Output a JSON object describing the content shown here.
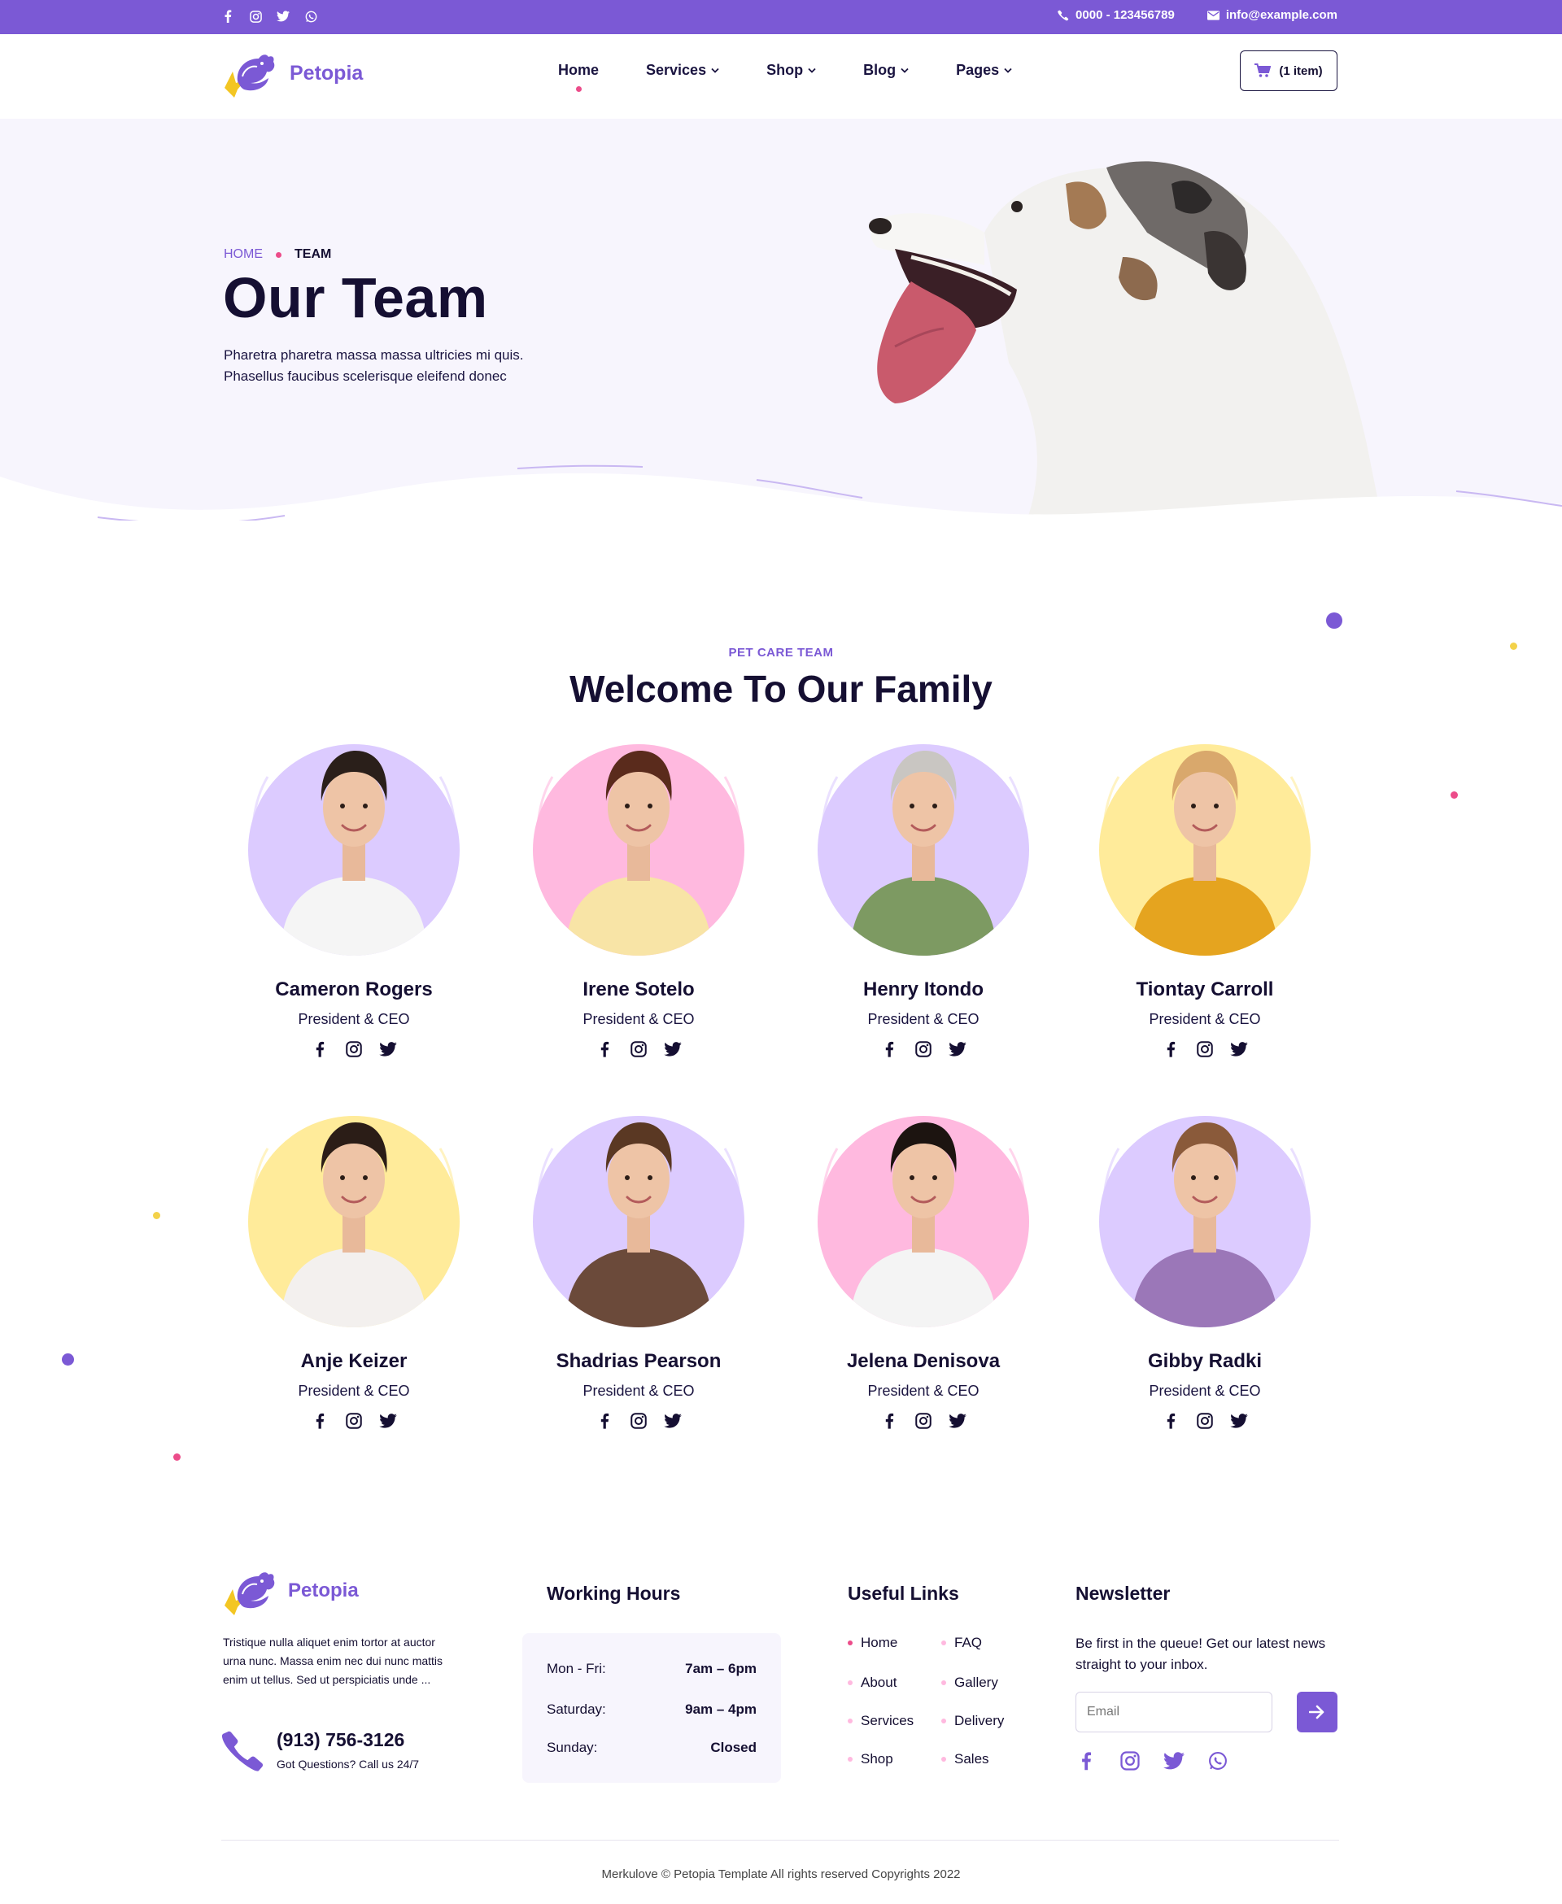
{
  "topbar": {
    "socials": [
      "facebook-icon",
      "instagram-icon",
      "twitter-icon",
      "whatsapp-icon"
    ],
    "phone": "0000 - 123456789",
    "email": "info@example.com"
  },
  "header": {
    "brand": "Petopia",
    "nav": [
      {
        "label": "Home",
        "active": true
      },
      {
        "label": "Services",
        "dropdown": true
      },
      {
        "label": "Shop",
        "dropdown": true
      },
      {
        "label": "Blog",
        "dropdown": true
      },
      {
        "label": "Pages",
        "dropdown": true
      }
    ],
    "cart_label": "(1 item)"
  },
  "hero": {
    "breadcrumb_home": "HOME",
    "breadcrumb_current": "TEAM",
    "title": "Our Team",
    "description_line1": "Pharetra pharetra massa massa ultricies mi quis.",
    "description_line2": "Phasellus faucibus scelerisque eleifend donec"
  },
  "team": {
    "subtitle": "PET CARE TEAM",
    "title": "Welcome To Our Family",
    "members": [
      {
        "name": "Cameron Rogers",
        "role": "President & CEO",
        "bg": "#dccbff",
        "shirt": "#f5f5f5",
        "hair": "#2a1f1a"
      },
      {
        "name": "Irene Sotelo",
        "role": "President & CEO",
        "bg": "#ffb9df",
        "shirt": "#f8e4a6",
        "hair": "#5a2b1c"
      },
      {
        "name": "Henry Itondo",
        "role": "President & CEO",
        "bg": "#dccbff",
        "shirt": "#7d9a62",
        "hair": "#c9c6c2"
      },
      {
        "name": "Tiontay Carroll",
        "role": "President & CEO",
        "bg": "#ffeb9a",
        "shirt": "#e5a41f",
        "hair": "#d9a86c"
      },
      {
        "name": "Anje Keizer",
        "role": "President & CEO",
        "bg": "#ffeb9a",
        "shirt": "#f3f0ee",
        "hair": "#2b1d17"
      },
      {
        "name": "Shadrias Pearson",
        "role": "President & CEO",
        "bg": "#dccbff",
        "shirt": "#6b4a3a",
        "hair": "#5a3823"
      },
      {
        "name": "Jelena Denisova",
        "role": "President & CEO",
        "bg": "#ffb9df",
        "shirt": "#f4f4f4",
        "hair": "#1c1410"
      },
      {
        "name": "Gibby Radki",
        "role": "President & CEO",
        "bg": "#dccbff",
        "shirt": "#9b77b8",
        "hair": "#8a5a3a"
      }
    ]
  },
  "footer": {
    "brand": "Petopia",
    "about": "Tristique nulla aliquet enim tortor at auctor urna nunc. Massa enim nec dui nunc mattis enim ut tellus. Sed ut perspiciatis unde ...",
    "phone": "(913) 756-3126",
    "phone_sub": "Got Questions? Call us 24/7",
    "hours_title": "Working Hours",
    "hours": [
      {
        "day": "Mon - Fri:",
        "time": "7am – 6pm"
      },
      {
        "day": "Saturday:",
        "time": "9am – 4pm"
      },
      {
        "day": "Sunday:",
        "time": "Closed"
      }
    ],
    "links_title": "Useful Links",
    "links_left": [
      "Home",
      "About",
      "Services",
      "Shop"
    ],
    "links_right": [
      "FAQ",
      "Gallery",
      "Delivery",
      "Sales"
    ],
    "newsletter_title": "Newsletter",
    "newsletter_text": "Be first in the queue! Get our latest news straight to your inbox.",
    "email_placeholder": "Email",
    "socials": [
      "facebook-icon",
      "instagram-icon",
      "twitter-icon",
      "whatsapp-icon"
    ],
    "copyright": "Merkulove © Petopia Template All rights reserved Copyrights 2022"
  },
  "colors": {
    "brand": "#7b59d5",
    "accent": "#ec4c8a",
    "dark": "#150f32"
  }
}
